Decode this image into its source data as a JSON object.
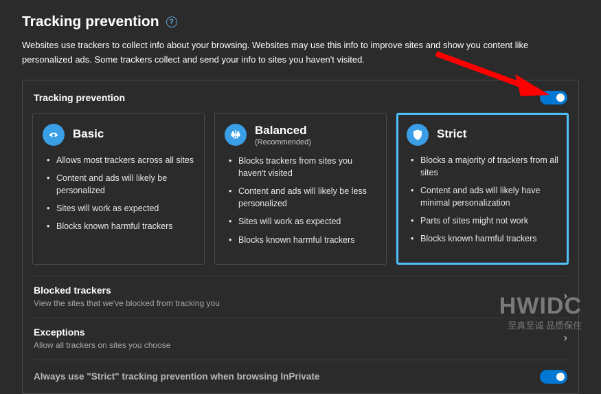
{
  "page": {
    "title": "Tracking prevention",
    "help_aria": "?",
    "description": "Websites use trackers to collect info about your browsing. Websites may use this info to improve sites and show you content like personalized ads. Some trackers collect and send your info to sites you haven't visited."
  },
  "panel": {
    "label": "Tracking prevention",
    "toggle_on": true
  },
  "cards": [
    {
      "key": "basic",
      "title": "Basic",
      "subtitle": "",
      "selected": false,
      "bullets": [
        "Allows most trackers across all sites",
        "Content and ads will likely be personalized",
        "Sites will work as expected",
        "Blocks known harmful trackers"
      ]
    },
    {
      "key": "balanced",
      "title": "Balanced",
      "subtitle": "(Recommended)",
      "selected": false,
      "bullets": [
        "Blocks trackers from sites you haven't visited",
        "Content and ads will likely be less personalized",
        "Sites will work as expected",
        "Blocks known harmful trackers"
      ]
    },
    {
      "key": "strict",
      "title": "Strict",
      "subtitle": "",
      "selected": true,
      "bullets": [
        "Blocks a majority of trackers from all sites",
        "Content and ads will likely have minimal personalization",
        "Parts of sites might not work",
        "Blocks known harmful trackers"
      ]
    }
  ],
  "rows": {
    "blocked": {
      "title": "Blocked trackers",
      "subtitle": "View the sites that we've blocked from tracking you"
    },
    "exceptions": {
      "title": "Exceptions",
      "subtitle": "Allow all trackers on sites you choose"
    },
    "inprivate": {
      "title": "Always use \"Strict\" tracking prevention when browsing InPrivate",
      "toggle_on": true
    }
  },
  "watermark": {
    "big": "HWIDC",
    "small": "至真至诚 品质保住"
  }
}
